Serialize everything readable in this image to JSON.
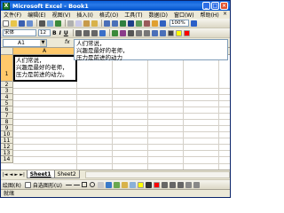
{
  "window": {
    "title": "Microsoft Excel - Book1",
    "app_icon": "excel-icon"
  },
  "menu": {
    "items": [
      "文件(F)",
      "编辑(E)",
      "视图(V)",
      "插入(I)",
      "格式(O)",
      "工具(T)",
      "数据(D)",
      "窗口(W)",
      "帮助(H)"
    ],
    "close_glyph": "×"
  },
  "toolbar": {
    "zoom": "100%",
    "font_name": "宋体",
    "font_size": "12",
    "bold": "B",
    "italic": "I",
    "underline": "U"
  },
  "formula_bar": {
    "name_box": "A1",
    "fx_label": "fx",
    "content": "人们常说，\n兴趣是最好的老师，\n压力是前进的动力"
  },
  "grid": {
    "columns": [
      "A",
      "B",
      "C",
      "D",
      "E",
      "F"
    ],
    "rows": [
      "1",
      "2",
      "3",
      "4",
      "5",
      "6",
      "7",
      "8",
      "9",
      "10",
      "11",
      "12",
      "13",
      "14"
    ],
    "active_cell_text": "人们常说，\n兴趣是最好的老师，\n压力是前进的动力。"
  },
  "sheets": {
    "tabs": [
      "Sheet1",
      "Sheet2"
    ],
    "active": "Sheet1"
  },
  "draw_toolbar": {
    "draw_label": "绘图(R)",
    "autoshapes_label": "自选图形(U)"
  },
  "status": {
    "text": "就绪"
  },
  "colors": {
    "title_bar": "#0a5fd8",
    "active_header": "#ffc96b",
    "chrome": "#ece9d8"
  }
}
